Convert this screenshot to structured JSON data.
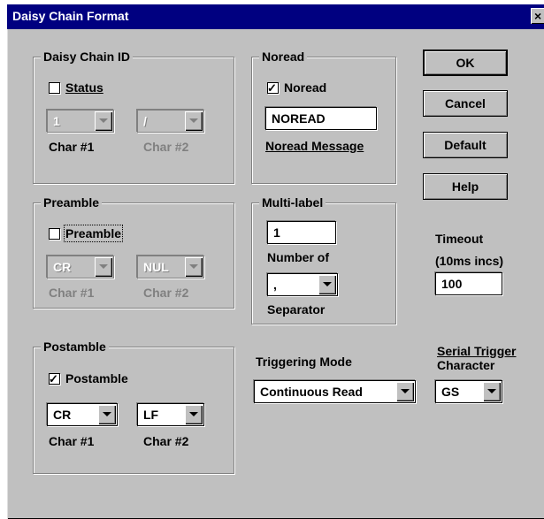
{
  "window": {
    "title": "Daisy Chain Format",
    "close_glyph": "×"
  },
  "daisy_chain_id": {
    "legend": "Daisy Chain ID",
    "status_label": "Status",
    "status_checked": false,
    "char1_value": "1",
    "char2_value": "/",
    "char1_label": "Char #1",
    "char2_label": "Char #2"
  },
  "noread": {
    "legend": "Noread",
    "checkbox_label": "Noread",
    "checked": true,
    "message_value": "NOREAD",
    "message_label": "Noread Message"
  },
  "preamble": {
    "legend": "Preamble",
    "checkbox_label": "Preamble",
    "checked": false,
    "char1_value": "CR",
    "char2_value": "NUL",
    "char1_label": "Char #1",
    "char2_label": "Char #2"
  },
  "multilabel": {
    "legend": "Multi-label",
    "number_value": "1",
    "number_label": "Number of",
    "separator_value": ",",
    "separator_label": "Separator"
  },
  "postamble": {
    "legend": "Postamble",
    "checkbox_label": "Postamble",
    "checked": true,
    "char1_value": "CR",
    "char2_value": "LF",
    "char1_label": "Char #1",
    "char2_label": "Char #2"
  },
  "timeout": {
    "label_line1": "Timeout",
    "label_line2": "(10ms incs)",
    "value": "100"
  },
  "triggering": {
    "label": "Triggering Mode",
    "value": "Continuous Read"
  },
  "serial_trigger": {
    "label_line1": "Serial Trigger",
    "label_line2": "Character",
    "value": "GS"
  },
  "buttons": {
    "ok": "OK",
    "cancel": "Cancel",
    "default": "Default",
    "help": "Help"
  }
}
